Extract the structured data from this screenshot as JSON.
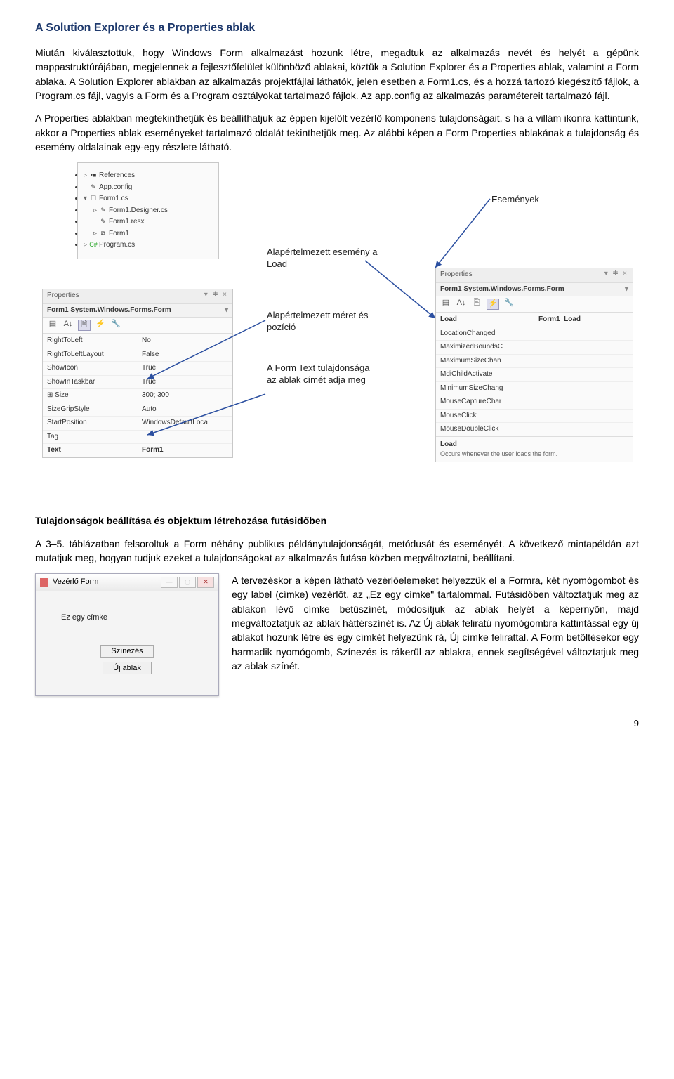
{
  "title": "A Solution Explorer és a Properties ablak",
  "para1": "Miután kiválasztottuk, hogy Windows Form alkalmazást hozunk létre, megadtuk az alkalmazás nevét és helyét a gépünk mappastruktúrájában, megjelennek a fejlesztőfelület különböző ablakai, köztük a Solution Explorer és a Properties ablak, valamint a Form ablaka. A Solution Explorer ablakban az alkalmazás projektfájlai láthatók, jelen esetben a Form1.cs, és a hozzá tartozó kiegészítő fájlok, a Program.cs fájl, vagyis a Form és a Program osztályokat tartalmazó fájlok. Az app.config az alkalmazás paramétereit tartalmazó fájl.",
  "para2": "A Properties ablakban megtekinthetjük és beállíthatjuk az éppen kijelölt vezérlő komponens tulajdonságait, s ha a villám ikonra kattintunk, akkor a Properties ablak eseményeket tartalmazó oldalát tekinthetjük meg. Az alábbi képen a Form Properties ablakának a tulajdonság és esemény oldalainak egy-egy részlete látható.",
  "solution": {
    "items": [
      {
        "pre": "▹",
        "ico": "•■",
        "label": "References"
      },
      {
        "pre": "",
        "ico": "✎",
        "label": "App.config"
      },
      {
        "pre": "▾",
        "ico": "☐",
        "label": "Form1.cs"
      },
      {
        "pre": "▹",
        "ico": "✎",
        "label": "Form1.Designer.cs"
      },
      {
        "pre": "",
        "ico": "✎",
        "label": "Form1.resx"
      },
      {
        "pre": "▹",
        "ico": "⧉",
        "label": "Form1"
      },
      {
        "pre": "▹",
        "ico": "C#",
        "label": "Program.cs"
      }
    ]
  },
  "propsLeft": {
    "header": "Properties",
    "object": "Form1 System.Windows.Forms.Form",
    "rows": [
      {
        "k": "RightToLeft",
        "v": "No"
      },
      {
        "k": "RightToLeftLayout",
        "v": "False"
      },
      {
        "k": "ShowIcon",
        "v": "True"
      },
      {
        "k": "ShowInTaskbar",
        "v": "True"
      },
      {
        "k": "⊞ Size",
        "v": "300; 300"
      },
      {
        "k": "SizeGripStyle",
        "v": "Auto"
      },
      {
        "k": "StartPosition",
        "v": "WindowsDefaultLoca"
      },
      {
        "k": "Tag",
        "v": ""
      },
      {
        "k": "Text",
        "v": "Form1"
      }
    ]
  },
  "propsRight": {
    "header": "Properties",
    "object": "Form1 System.Windows.Forms.Form",
    "rows": [
      {
        "k": "Load",
        "v": "Form1_Load"
      },
      {
        "k": "LocationChanged",
        "v": ""
      },
      {
        "k": "MaximizedBoundsC",
        "v": ""
      },
      {
        "k": "MaximumSizeChan",
        "v": ""
      },
      {
        "k": "MdiChildActivate",
        "v": ""
      },
      {
        "k": "MinimumSizeChang",
        "v": ""
      },
      {
        "k": "MouseCaptureChar",
        "v": ""
      },
      {
        "k": "MouseClick",
        "v": ""
      },
      {
        "k": "MouseDoubleClick",
        "v": ""
      }
    ],
    "infoTitle": "Load",
    "infoText": "Occurs whenever the user loads the form."
  },
  "annotations": {
    "events": "Események",
    "load": "Alapértelmezett esemény a Load",
    "size": "Alapértelmezett méret és pozíció",
    "text": "A Form Text tulajdonsága az ablak címét adja meg"
  },
  "subheading": "Tulajdonságok beállítása és objektum létrehozása futásidőben",
  "para3": "A 3–5. táblázatban felsoroltuk a Form néhány publikus példánytulajdonságát, metódusát és eseményét. A következő mintapéldán azt mutatjuk meg, hogyan tudjuk ezeket a tulajdonságokat az alkalmazás futása közben megváltoztatni, beállítani.",
  "para4": "A tervezéskor a képen látható vezérlőelemeket helyezzük el a Formra, két nyomógombot és egy label (címke) vezérlőt, az „Ez egy címke\" tartalommal. Futásidőben változtatjuk meg az ablakon lévő címke betűszínét, módosítjuk az ablak helyét a képernyőn, majd megváltoztatjuk az ablak háttérszínét is. Az Új ablak feliratú nyomógombra kattintással egy új ablakot hozunk létre és egy címkét helyezünk rá, Új címke felirattal. A Form betöltésekor egy harmadik nyomógomb, Színezés is rákerül az ablakra, ennek segítségével változtatjuk meg az ablak színét.",
  "winform": {
    "title": "Vezérlő Form",
    "label": "Ez egy címke",
    "btn1": "Színezés",
    "btn2": "Új ablak"
  },
  "pageNum": "9"
}
